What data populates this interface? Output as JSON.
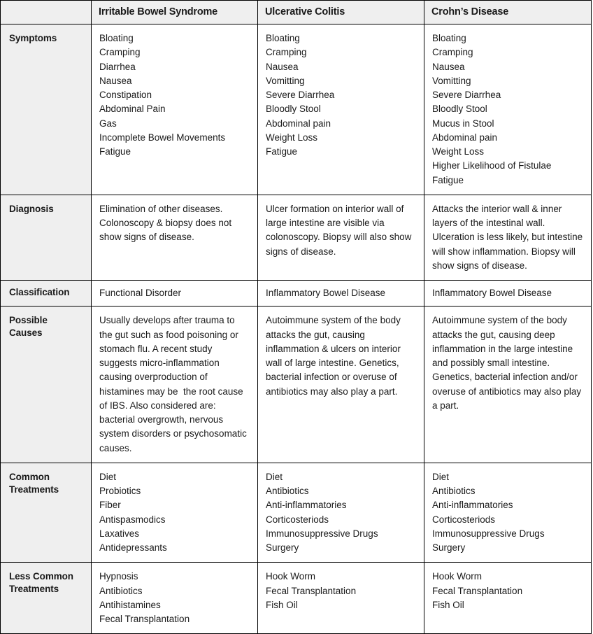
{
  "table": {
    "headers": {
      "corner": "",
      "columns": [
        "Irritable Bowel Syndrome",
        "Ulcerative Colitis",
        "Crohn’s Disease"
      ]
    },
    "row_labels": {
      "symptoms": "Symptoms",
      "diagnosis": "Diagnosis",
      "classification": "Classification",
      "possible_causes_line1": "Possible",
      "possible_causes_line2": "Causes",
      "common_treatments_line1": "Common",
      "common_treatments_line2": "Treatments",
      "less_common_treatments_line1": "Less Common",
      "less_common_treatments_line2": "Treatments"
    },
    "symptoms": {
      "ibs": [
        "Bloating",
        "Cramping",
        "Diarrhea",
        "Nausea",
        "Constipation",
        "Abdominal Pain",
        "Gas",
        "Incomplete Bowel Movements",
        "Fatigue"
      ],
      "uc": [
        "Bloating",
        "Cramping",
        "Nausea",
        "Vomitting",
        "Severe Diarrhea",
        "Bloodly Stool",
        "Abdominal pain",
        "Weight Loss",
        "Fatigue"
      ],
      "cd": [
        "Bloating",
        "Cramping",
        "Nausea",
        "Vomitting",
        "Severe Diarrhea",
        "Bloodly Stool",
        "Mucus in Stool",
        "Abdominal pain",
        "Weight Loss",
        "Higher Likelihood of Fistulae",
        "Fatigue"
      ]
    },
    "diagnosis": {
      "ibs": "Elimination of other diseases. Colonoscopy & biopsy does not show signs of disease.",
      "uc": "Ulcer formation on interior wall of large intestine are visible via colonoscopy. Biopsy will also show signs of disease.",
      "cd": "Attacks the interior wall & inner layers of the intestinal wall. Ulceration is less likely, but intestine will show inflammation. Biopsy will show signs of disease."
    },
    "classification": {
      "ibs": "Functional Disorder",
      "uc": "Inflammatory Bowel Disease",
      "cd": "Inflammatory Bowel Disease"
    },
    "possible_causes": {
      "ibs": "Usually develops after trauma to the gut such as food poisoning or stomach flu. A recent study suggests micro-inflammation causing overproduction of histamines may be  the root cause of IBS. Also considered are: bacterial overgrowth, nervous system disorders or psychosomatic causes.",
      "uc": "Autoimmune system of the body attacks the gut, causing inflammation & ulcers on interior wall of large intestine. Genetics, bacterial infection or overuse of antibiotics may also play a part.",
      "cd": "Autoimmune system of the body attacks the gut, causing deep inflammation in the large intestine and possibly small intestine. Genetics, bacterial infection and/or overuse of antibiotics may also play a part."
    },
    "common_treatments": {
      "ibs": [
        "Diet",
        "Probiotics",
        "Fiber",
        "Antispasmodics",
        "Laxatives",
        "Antidepressants"
      ],
      "uc": [
        "Diet",
        "Antibiotics",
        "Anti-inflammatories",
        "Corticosteriods",
        "Immunosuppressive Drugs",
        "Surgery"
      ],
      "cd": [
        "Diet",
        "Antibiotics",
        "Anti-inflammatories",
        "Corticosteriods",
        "Immunosuppressive Drugs",
        "Surgery"
      ]
    },
    "less_common_treatments": {
      "ibs": [
        "Hypnosis",
        "Antibiotics",
        "Antihistamines",
        "Fecal Transplantation"
      ],
      "uc": [
        "Hook Worm",
        "Fecal Transplantation",
        "Fish Oil"
      ],
      "cd": [
        "Hook Worm",
        "Fecal Transplantation",
        "Fish Oil"
      ]
    }
  },
  "colors": {
    "border": "#000000",
    "header_background": "#efefef",
    "label_background": "#efefef",
    "cell_background": "#ffffff",
    "text": "#1a1a1a"
  }
}
